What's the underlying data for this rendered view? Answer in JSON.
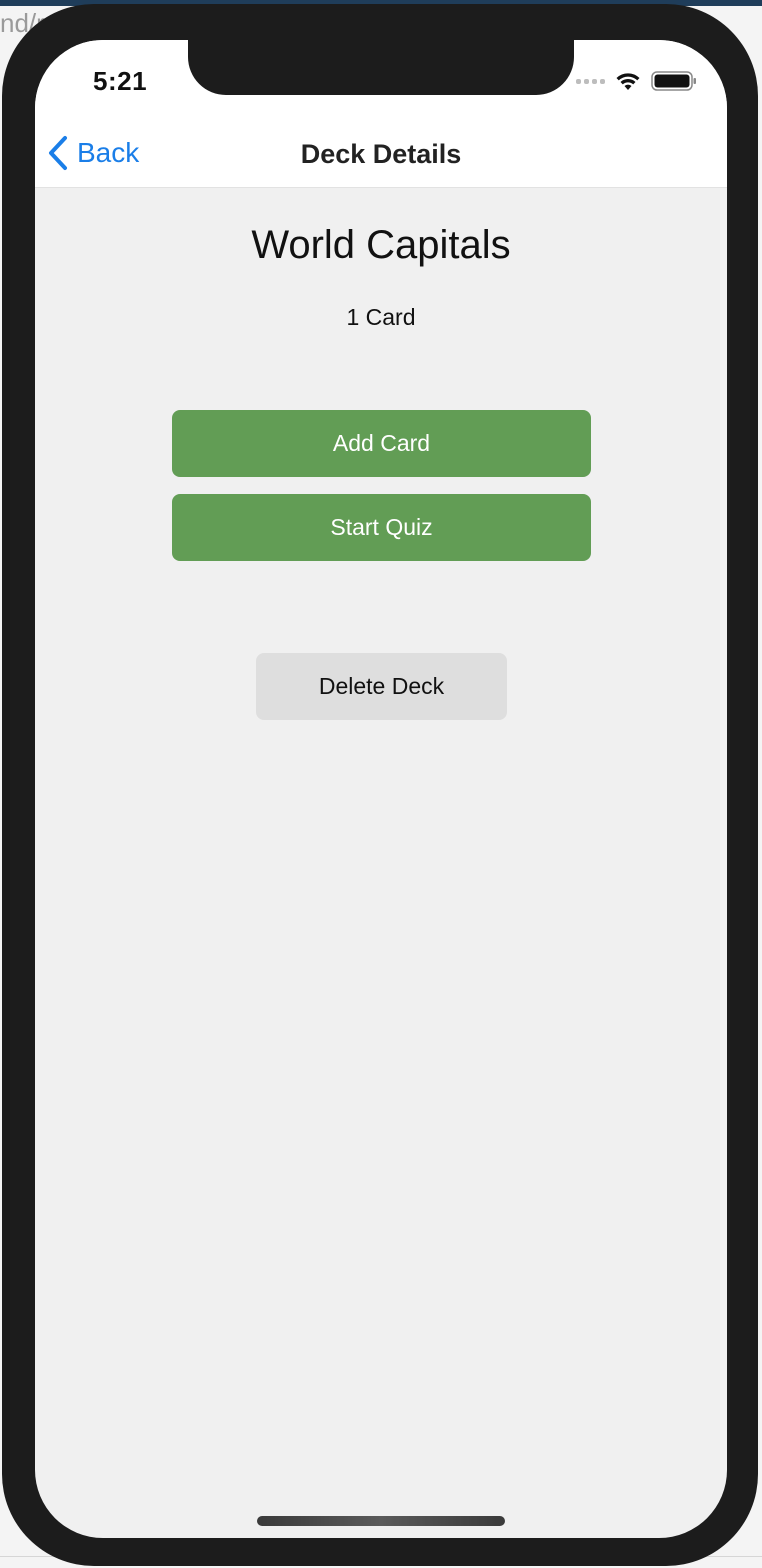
{
  "background": {
    "partial_text_top": "nd/r"
  },
  "status_bar": {
    "time": "5:21"
  },
  "nav": {
    "back_label": "Back",
    "title": "Deck Details"
  },
  "deck": {
    "title": "World Capitals",
    "card_count": "1 Card"
  },
  "buttons": {
    "add_card": "Add Card",
    "start_quiz": "Start Quiz",
    "delete_deck": "Delete Deck"
  },
  "colors": {
    "accent_blue": "#1a7ee8",
    "button_green": "#629d55",
    "button_gray": "#dedede",
    "screen_bg": "#f0f0f0",
    "device_frame": "#1c1c1c"
  },
  "icons": {
    "back": "chevron-left-icon",
    "wifi": "wifi-icon",
    "battery": "battery-icon",
    "signal": "signal-icon"
  }
}
